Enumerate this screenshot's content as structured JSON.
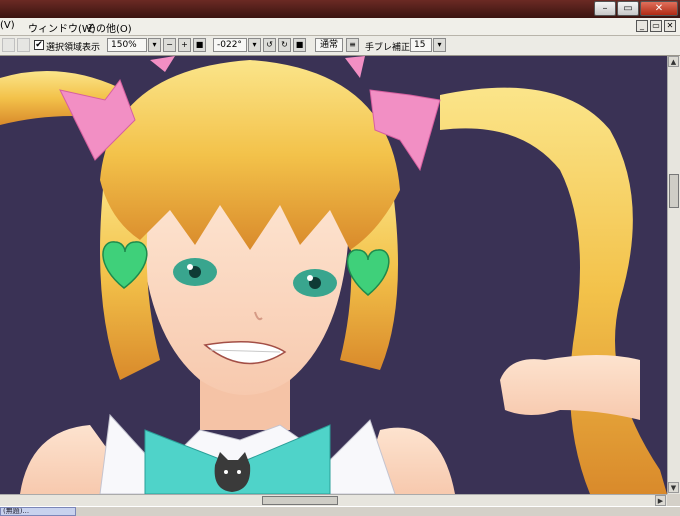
{
  "menu": {
    "items": [
      {
        "label": "(V)"
      },
      {
        "label": "ウィンドウ(W)"
      },
      {
        "label": "その他(O)"
      }
    ]
  },
  "window_controls": {
    "minimize": "–",
    "restore": "▭",
    "close": "✕"
  },
  "mdi_controls": {
    "minimize": "_",
    "restore": "▭",
    "close": "✕"
  },
  "toolbar": {
    "selection_label": "選択領域表示",
    "selection_checked": "✔",
    "zoom_value": "150%",
    "rotation_value": "-022°",
    "blend_mode": "通常",
    "stabilizer_label": "手ブレ補正",
    "stabilizer_value": "15"
  },
  "status": {
    "tab_label": "(無題)..."
  },
  "colors": {
    "canvas_bg": "#3a3255",
    "accent_bow": "#f28fc4",
    "hair": "#f3c24a",
    "gem": "#3fd07a",
    "ribbon": "#4fd3c9"
  },
  "icons": [
    "dropdown-arrow-icon",
    "zoom-in-icon",
    "zoom-out-icon",
    "rotate-left-icon",
    "rotate-right-icon",
    "checkbox-icon",
    "scroll-arrow-icon"
  ]
}
